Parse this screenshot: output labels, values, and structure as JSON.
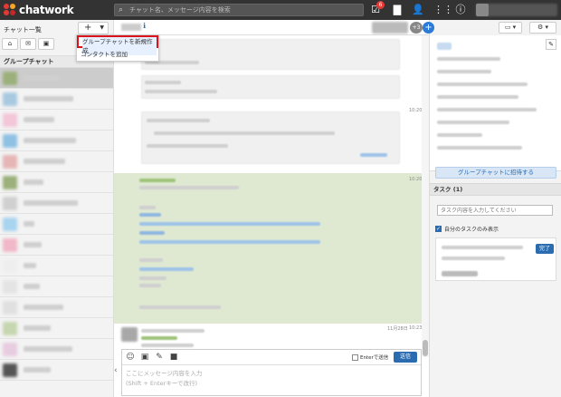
{
  "app": {
    "name": "chatwork"
  },
  "header": {
    "search_placeholder": "チャット名、メッセージ内容を検索",
    "notification_count": "6"
  },
  "left": {
    "title": "チャット一覧",
    "add_button": "+",
    "section_label": "グループチャット",
    "room_count": 17
  },
  "dropdown": {
    "items": [
      {
        "label": "グループチャットを新規作成",
        "highlighted": true
      },
      {
        "label": "コンタクトを追加"
      }
    ]
  },
  "main": {
    "member_count": "+3",
    "times": [
      "10:20",
      "10:20",
      "10:23"
    ],
    "date_label": "11月28日"
  },
  "composer": {
    "enter_send_label": "Enterで送信",
    "send_label": "送信",
    "placeholder_line1": "ここにメッセージ内容を入力",
    "placeholder_line2": "(Shift + Enterキーで改行)"
  },
  "right": {
    "invite_label": "グループチャットに招待する",
    "task_header": "タスク (1)",
    "task_input_placeholder": "タスク内容を入力してください",
    "my_tasks_label": "自分のタスクのみ表示",
    "done_label": "完了"
  },
  "colors": {
    "topbar": "#333333",
    "accent_blue": "#2b6cb0",
    "highlight_red": "#d9141c",
    "message_green": "#dfe9d2"
  }
}
